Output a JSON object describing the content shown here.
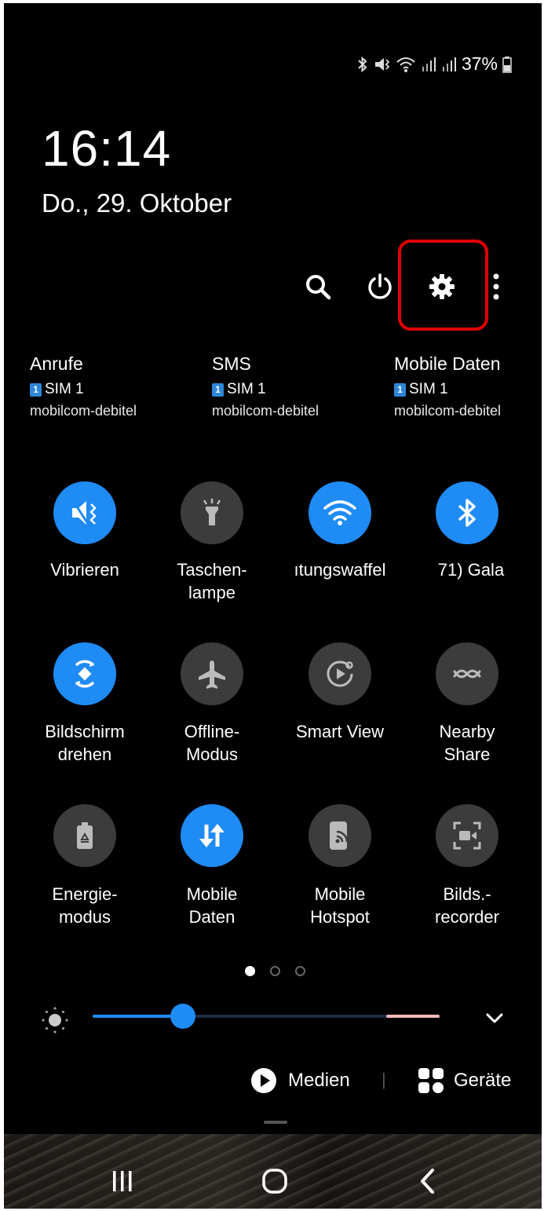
{
  "status_bar": {
    "icons": [
      "bluetooth-icon",
      "vibrate-icon",
      "wifi-icon",
      "signal-icon",
      "signal-icon",
      "battery-icon"
    ],
    "battery": "37%"
  },
  "clock": {
    "time": "16:14",
    "date": "Do., 29. Oktober"
  },
  "toolbar": {
    "icons": [
      "search-icon",
      "power-icon",
      "settings-gear-icon",
      "more-options-icon"
    ],
    "highlight_color": "#e00000"
  },
  "sim": [
    {
      "title": "Anrufe",
      "badge": "1",
      "sim": "SIM 1",
      "carrier": "mobilcom-debitel"
    },
    {
      "title": "SMS",
      "badge": "1",
      "sim": "SIM 1",
      "carrier": "mobilcom-debitel"
    },
    {
      "title": "Mobile Daten",
      "badge": "1",
      "sim": "SIM 1",
      "carrier": "mobilcom-debitel"
    }
  ],
  "tiles": [
    {
      "label": "Vibrieren",
      "on": true,
      "icon": "vibrate-icon"
    },
    {
      "label": "Taschen-\nlampe",
      "on": false,
      "icon": "flashlight-icon"
    },
    {
      "label": "ıtungswaffel",
      "on": true,
      "icon": "wifi-icon"
    },
    {
      "label": "71)     Gala",
      "on": true,
      "icon": "bluetooth-icon"
    },
    {
      "label": "Bildschirm\ndrehen",
      "on": true,
      "icon": "auto-rotate-icon"
    },
    {
      "label": "Offline-\nModus",
      "on": false,
      "icon": "airplane-icon"
    },
    {
      "label": "Smart View",
      "on": false,
      "icon": "smart-view-icon"
    },
    {
      "label": "Nearby\nShare",
      "on": false,
      "icon": "nearby-share-icon"
    },
    {
      "label": "Energie-\nmodus",
      "on": false,
      "icon": "power-mode-icon"
    },
    {
      "label": "Mobile\nDaten",
      "on": true,
      "icon": "mobile-data-icon"
    },
    {
      "label": "Mobile\nHotspot",
      "on": false,
      "icon": "hotspot-icon"
    },
    {
      "label": "Bilds.-\nrecorder",
      "on": false,
      "icon": "screen-recorder-icon"
    }
  ],
  "pages": {
    "count": 3,
    "current": 1
  },
  "brightness": {
    "level": 0.26
  },
  "media": {
    "medien_label": "Medien",
    "geraete_label": "Geräte",
    "separator": "|"
  },
  "nav": {
    "icons": [
      "recent-apps-icon",
      "home-icon",
      "back-icon"
    ]
  },
  "colors": {
    "accent": "#1f8bf5",
    "tile_off": "#3c3c3c",
    "background": "#000000"
  }
}
